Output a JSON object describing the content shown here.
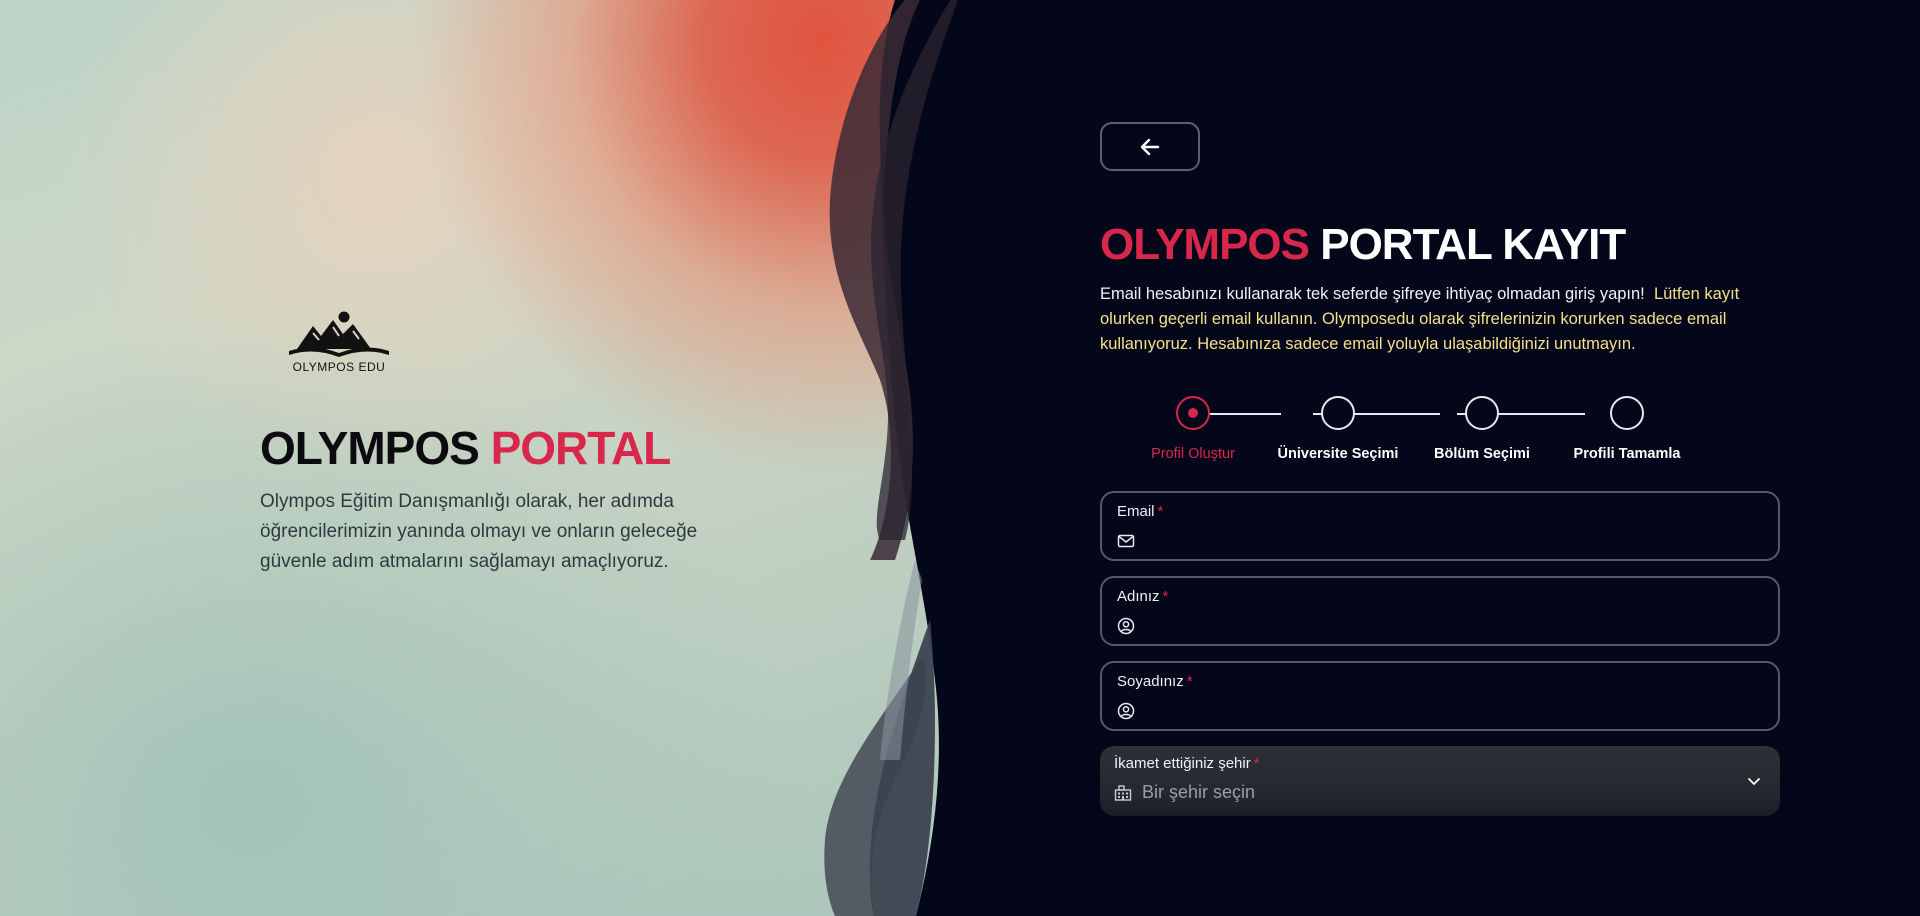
{
  "brand": {
    "logo_text": "OLYMPOS EDU",
    "hero_title_main": "OLYMPOS",
    "hero_title_accent": "PORTAL",
    "hero_description": "Olympos Eğitim Danışmanlığı olarak, her adımda öğrencilerimizin yanında olmayı ve onların geleceğe güvenle adım atmalarını sağlamayı amaçlıyoruz."
  },
  "form": {
    "title_accent": "OLYMPOS",
    "title_main": "PORTAL KAYIT",
    "info_text": "Email hesabınızı kullanarak tek seferde şifreye ihtiyaç olmadan giriş yapın!",
    "warning_text": "Lütfen kayıt olurken geçerli email kullanın. Olymposedu olarak şifrelerinizin korurken sadece email kullanıyoruz. Hesabınıza sadece email yoluyla ulaşabildiğinizi unutmayın.",
    "required_mark": "*",
    "steps": [
      {
        "label": "Profil Oluştur",
        "active": true
      },
      {
        "label": "Üniversite Seçimi",
        "active": false
      },
      {
        "label": "Bölüm Seçimi",
        "active": false
      },
      {
        "label": "Profili Tamamla",
        "active": false
      }
    ],
    "fields": {
      "email": {
        "label": "Email",
        "value": ""
      },
      "first_name": {
        "label": "Adınız",
        "value": ""
      },
      "last_name": {
        "label": "Soyadınız",
        "value": ""
      },
      "city": {
        "label": "İkamet ettiğiniz şehir",
        "placeholder": "Bir şehir seçin"
      }
    }
  },
  "colors": {
    "accent": "#d9274c",
    "warning": "#f3e08a",
    "background": "#04061a"
  },
  "icons": {
    "back": "arrow-left-icon",
    "email": "mail-icon",
    "first_name": "user-circle-icon",
    "last_name": "user-circle-icon",
    "city": "building-icon",
    "dropdown": "chevron-down-icon"
  }
}
